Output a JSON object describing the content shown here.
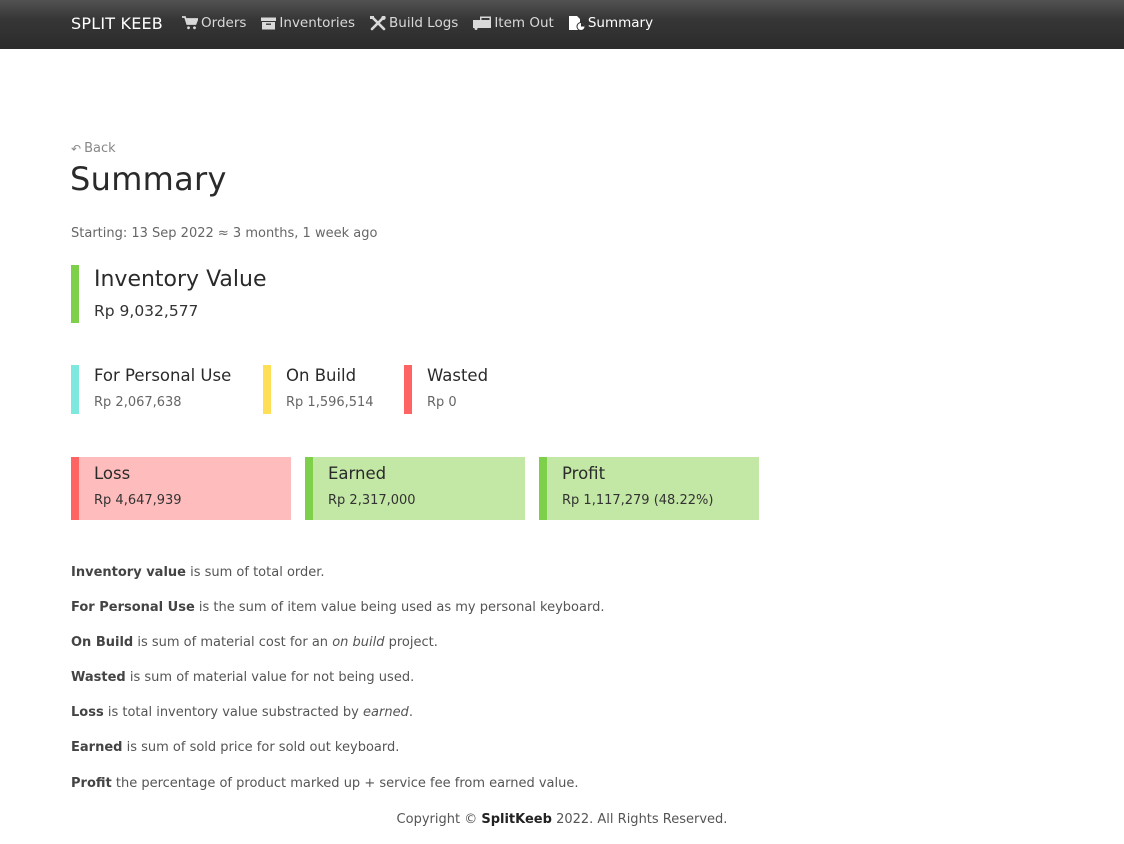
{
  "navbar": {
    "brand": "SPLIT KEEB",
    "items": [
      {
        "label": "Orders",
        "icon": "cart-icon"
      },
      {
        "label": "Inventories",
        "icon": "archive-box-icon"
      },
      {
        "label": "Build Logs",
        "icon": "tools-icon"
      },
      {
        "label": "Item Out",
        "icon": "truck-box-icon"
      },
      {
        "label": "Summary",
        "icon": "file-chart-icon",
        "active": true
      }
    ]
  },
  "page": {
    "back_label": "Back",
    "title": "Summary",
    "starting": "Starting: 13 Sep 2022 ≈ 3 months, 1 week ago"
  },
  "inventory": {
    "label": "Inventory Value",
    "value": "Rp 9,032,577",
    "color": "#7ed04b"
  },
  "breakdown": [
    {
      "label": "For Personal Use",
      "value": "Rp 2,067,638",
      "color": "#7ee8df"
    },
    {
      "label": "On Build",
      "value": "Rp 1,596,514",
      "color": "#ffdf57"
    },
    {
      "label": "Wasted",
      "value": "Rp 0",
      "color": "#ff6464"
    }
  ],
  "cards": [
    {
      "label": "Loss",
      "value": "Rp 4,647,939",
      "bar": "#ff6464",
      "bg": "#ffbcbc"
    },
    {
      "label": "Earned",
      "value": "Rp 2,317,000",
      "bar": "#7ed04b",
      "bg": "#c3e7a5"
    },
    {
      "label": "Profit",
      "value": "Rp 1,117,279 (48.22%)",
      "bar": "#7ed04b",
      "bg": "#c3e7a5"
    }
  ],
  "notes": [
    {
      "term": "Inventory value",
      "text": " is sum of total order."
    },
    {
      "term": "For Personal Use",
      "text": " is the sum of item value being used as my personal keyboard."
    },
    {
      "term": "On Build",
      "pre": " is sum of material cost for an ",
      "em": "on build",
      "post": " project."
    },
    {
      "term": "Wasted",
      "text": " is sum of material value for not being used."
    },
    {
      "term": "Loss",
      "pre": " is total inventory value substracted by ",
      "em": "earned",
      "post": "."
    },
    {
      "term": "Earned",
      "text": " is sum of sold price for sold out keyboard."
    },
    {
      "term": "Profit",
      "text": " the percentage of product marked up + service fee from earned value."
    }
  ],
  "footer": {
    "pre": "Copyright © ",
    "brand": "SplitKeeb",
    "post": " 2022. All Rights Reserved."
  }
}
